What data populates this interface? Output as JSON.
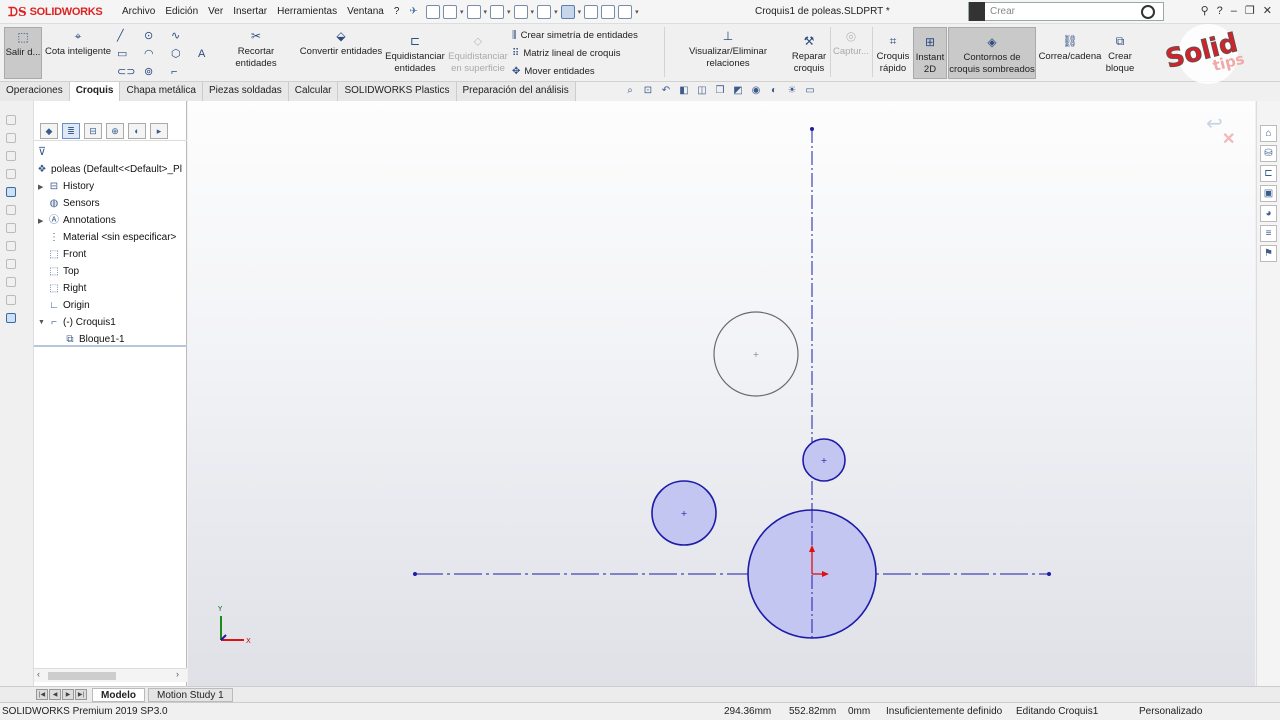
{
  "app": {
    "brand": "SOLIDWORKS",
    "document_title": "Croquis1 de poleas.SLDPRT *",
    "search_placeholder": "Crear"
  },
  "menu": [
    "Archivo",
    "Edición",
    "Ver",
    "Insertar",
    "Herramientas",
    "Ventana",
    "?"
  ],
  "ribbon": {
    "exit_sketch": "Salir d...",
    "smart_dimension": "Cota inteligente",
    "trim": "Recortar entidades",
    "convert": "Convertir entidades",
    "offset_1": "Equidistanciar",
    "offset_2": "entidades",
    "offset_surface_1": "Equidistanciar",
    "offset_surface_2": "en superficie",
    "mirror": "Crear simetría de entidades",
    "linear_pattern": "Matriz lineal de croquis",
    "move": "Mover entidades",
    "relations": "Visualizar/Eliminar relaciones",
    "repair_1": "Reparar",
    "repair_2": "croquis",
    "capture": "Captur...",
    "quick_sketch_1": "Croquis",
    "quick_sketch_2": "rápido",
    "instant2d_1": "Instant",
    "instant2d_2": "2D",
    "shaded_1": "Contornos de",
    "shaded_2": "croquis sombreados",
    "belt": "Correa/cadena",
    "make_block_1": "Crear",
    "make_block_2": "bloque"
  },
  "badge": {
    "line1": "Solid",
    "line2": "tips"
  },
  "tabs": [
    {
      "label": "Operaciones",
      "active": false
    },
    {
      "label": "Croquis",
      "active": true
    },
    {
      "label": "Chapa metálica",
      "active": false
    },
    {
      "label": "Piezas soldadas",
      "active": false
    },
    {
      "label": "Calcular",
      "active": false
    },
    {
      "label": "SOLIDWORKS Plastics",
      "active": false
    },
    {
      "label": "Preparación del análisis",
      "active": false
    }
  ],
  "tree": {
    "root": "poleas  (Default<<Default>_Pl",
    "history": "History",
    "sensors": "Sensors",
    "annotations": "Annotations",
    "material": "Material <sin especificar>",
    "front": "Front",
    "top": "Top",
    "right": "Right",
    "origin": "Origin",
    "sketch": "(-) Croquis1",
    "block": "Bloque1-1"
  },
  "sketch": {
    "triad_y": "Y",
    "triad_x": "X",
    "fill_color": "#c4c6f2",
    "line_color": "#1c1ca8",
    "construction_color": "#6a6a6a"
  },
  "bottom_tabs": [
    "Modelo",
    "Motion Study 1"
  ],
  "status": {
    "product": "SOLIDWORKS Premium 2019 SP3.0",
    "x": "294.36mm",
    "y": "552.82mm",
    "z": "0mm",
    "definition": "Insuficientemente definido",
    "editing": "Editando Croquis1",
    "units": "Personalizado"
  }
}
